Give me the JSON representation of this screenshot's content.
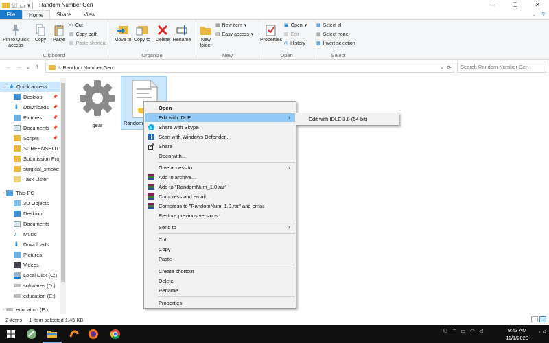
{
  "window": {
    "title": "Random Number Gen",
    "controls": [
      "—",
      "☐",
      "✕"
    ]
  },
  "tabs": [
    "File",
    "Home",
    "Share",
    "View"
  ],
  "ribbon": {
    "clipboard": {
      "label": "Clipboard",
      "pin": "Pin to Quick access",
      "copy": "Copy",
      "paste": "Paste",
      "cut": "Cut",
      "copy_path": "Copy path",
      "paste_shortcut": "Paste shortcut"
    },
    "organize": {
      "label": "Organize",
      "move_to": "Move to",
      "copy_to": "Copy to",
      "delete": "Delete",
      "rename": "Rename"
    },
    "new": {
      "label": "New",
      "new_folder": "New folder",
      "new_item": "New item",
      "easy_access": "Easy access"
    },
    "open": {
      "label": "Open",
      "properties": "Properties",
      "open": "Open",
      "edit": "Edit",
      "history": "History"
    },
    "select": {
      "label": "Select",
      "select_all": "Select all",
      "select_none": "Select none",
      "invert": "Invert selection"
    }
  },
  "address": {
    "path": "Random Number Gen",
    "search_placeholder": "Search Random Number Gen"
  },
  "nav": {
    "quick_access": "Quick access",
    "items": [
      {
        "label": "Desktop",
        "pinned": true
      },
      {
        "label": "Downloads",
        "pinned": true
      },
      {
        "label": "Pictures",
        "pinned": true
      },
      {
        "label": "Documents",
        "pinned": true
      },
      {
        "label": "Scripts",
        "pinned": true
      },
      {
        "label": "SCREENSHOTS"
      },
      {
        "label": "Submission Proj"
      },
      {
        "label": "surgical_smoke"
      },
      {
        "label": "Task Lister"
      }
    ],
    "this_pc": "This PC",
    "pc_items": [
      "3D Objects",
      "Desktop",
      "Documents",
      "Music",
      "Downloads",
      "Pictures",
      "Videos",
      "Local Disk (C:)",
      "softwares (D:)",
      "education (E:)"
    ],
    "extra_drive": "education (E:)"
  },
  "files": [
    {
      "name": "gear"
    },
    {
      "name": "Random"
    }
  ],
  "status": {
    "count": "2 items",
    "selection": "1 item selected  1.45 KB"
  },
  "context_menu": {
    "items": [
      "Open",
      "Edit with IDLE",
      "Share with Skype",
      "Scan with Windows Defender...",
      "Share",
      "Open with...",
      "Give access to",
      "Add to archive...",
      "Add to \"RandomNum_1.0.rar\"",
      "Compress and email...",
      "Compress to \"RandomNum_1.0.rar\" and email",
      "Restore previous versions",
      "Send to",
      "Cut",
      "Copy",
      "Paste",
      "Create shortcut",
      "Delete",
      "Rename",
      "Properties"
    ],
    "submenu_item": "Edit with IDLE 3.8 (64-bit)"
  },
  "taskbar": {
    "time": "9:43 AM",
    "date": "11/1/2020",
    "notifications": "2"
  },
  "colors": {
    "accent": "#1979ca",
    "selection": "#cce8ff",
    "menu_highlight": "#91c9f7",
    "folder": "#e8b93e"
  }
}
